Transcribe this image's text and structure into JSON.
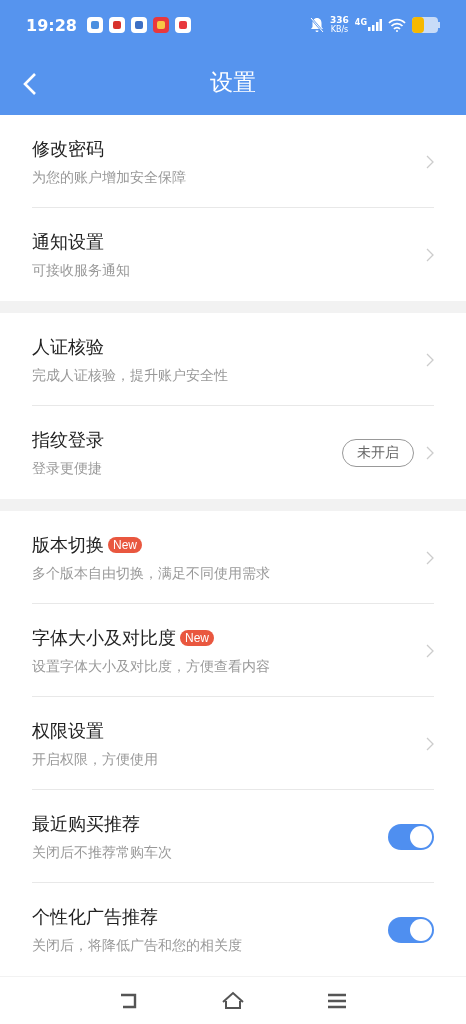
{
  "status_bar": {
    "time": "19:28",
    "speed": "336",
    "speed_unit": "KB/s",
    "network": "4G"
  },
  "header": {
    "title": "设置"
  },
  "groups": [
    {
      "items": [
        {
          "kind": "link",
          "title": "修改密码",
          "subtitle": "为您的账户增加安全保障"
        },
        {
          "kind": "link",
          "title": "通知设置",
          "subtitle": "可接收服务通知"
        }
      ]
    },
    {
      "items": [
        {
          "kind": "link",
          "title": "人证核验",
          "subtitle": "完成人证核验，提升账户安全性"
        },
        {
          "kind": "link",
          "title": "指纹登录",
          "subtitle": "登录更便捷",
          "status": "未开启"
        }
      ]
    },
    {
      "items": [
        {
          "kind": "link",
          "title": "版本切换",
          "subtitle": "多个版本自由切换，满足不同使用需求",
          "badge": "New"
        },
        {
          "kind": "link",
          "title": "字体大小及对比度",
          "subtitle": "设置字体大小及对比度，方便查看内容",
          "badge": "New"
        },
        {
          "kind": "link",
          "title": "权限设置",
          "subtitle": "开启权限，方便使用"
        },
        {
          "kind": "toggle",
          "title": "最近购买推荐",
          "subtitle": "关闭后不推荐常购车次",
          "on": true
        },
        {
          "kind": "toggle",
          "title": "个性化广告推荐",
          "subtitle": "关闭后，将降低广告和您的相关度",
          "on": true
        }
      ]
    }
  ]
}
